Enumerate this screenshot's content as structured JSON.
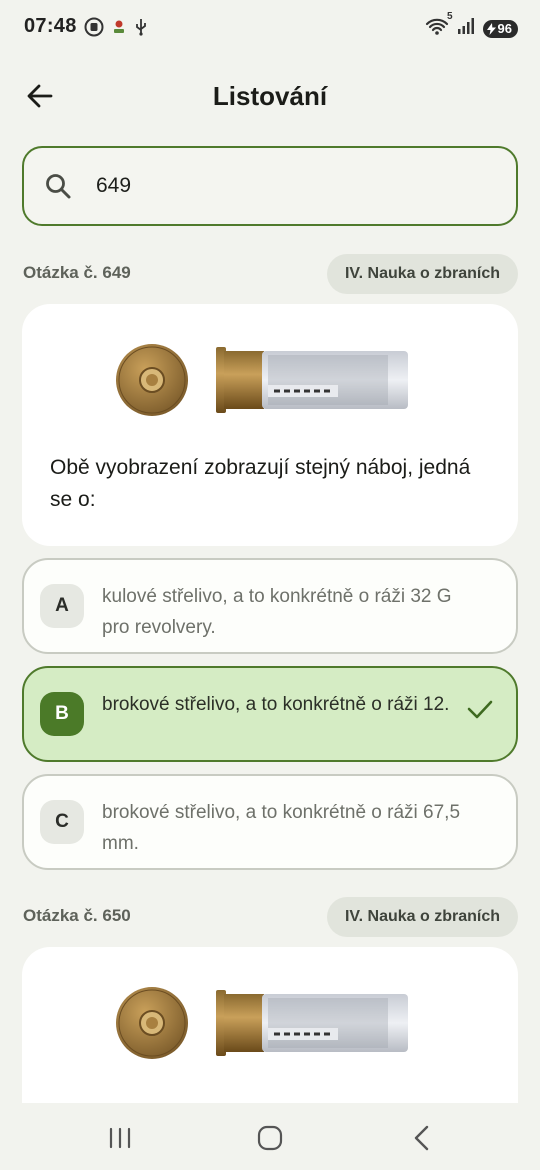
{
  "status_bar": {
    "time": "07:48",
    "battery": "96",
    "wifi_label": "5"
  },
  "header": {
    "title": "Listování"
  },
  "search": {
    "value": "649",
    "placeholder": ""
  },
  "questions": [
    {
      "number_label": "Otázka č. 649",
      "category": "IV. Nauka o zbraních",
      "text": "Obě vyobrazení zobrazují stejný náboj, jedná se o:",
      "answers": [
        {
          "letter": "A",
          "text": "kulové střelivo, a to konkrétně o ráži 32 G pro revolvery.",
          "correct": false
        },
        {
          "letter": "B",
          "text": "brokové střelivo, a to konkrétně o ráži 12.",
          "correct": true
        },
        {
          "letter": "C",
          "text": "brokové střelivo, a to konkrétně o ráži 67,5 mm.",
          "correct": false
        }
      ]
    },
    {
      "number_label": "Otázka č. 650",
      "category": "IV. Nauka o zbraních"
    }
  ],
  "colors": {
    "accent": "#4f7a2c",
    "correct_bg": "#d5ecc4",
    "background": "#f2f3ee"
  }
}
